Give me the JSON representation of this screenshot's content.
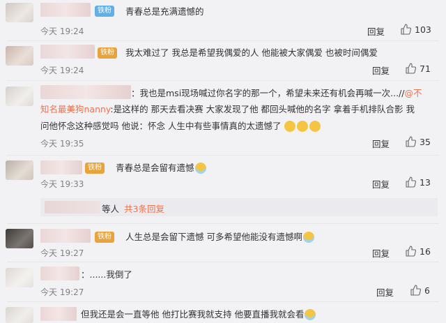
{
  "comments": [
    {
      "badge": "铁粉",
      "text": "青春总是充满遗憾的",
      "time": "今天 19:24",
      "reply": "回复",
      "likes": "103"
    },
    {
      "badge": "铁粉",
      "text": "我太难过了 我总是希望我偶爱的人 他能被大家偶爱 也被时间偶爱",
      "time": "今天 19:24",
      "reply": "回复",
      "likes": "71"
    },
    {
      "text_l1": "：我也是msi现场喊过你名字的那一个，希望未来还有机会再喊一次...//",
      "at1": "@不",
      "at2": "知名最美狗nanny",
      "text_l2": ":是这样的 那天去看决赛 大家发现了他 都回头喊他的名字 拿着手机排队合影 我",
      "text_l3": "问他怀念这种感觉吗 他说：怀念 人生中有些事情真的太遗憾了",
      "time": "今天 19:35",
      "reply": "回复",
      "likes": "35"
    },
    {
      "badge": "铁粉",
      "text": "青春总是会留有遗憾",
      "time": "今天 19:33",
      "reply": "回复",
      "likes": "13"
    },
    {
      "badge": "铁粉",
      "text": "人生总是会留下遗憾 可多希望他能没有遗憾啊",
      "time": "今天 19:27",
      "reply": "回复",
      "likes": "16"
    },
    {
      "text": "：......我倒了",
      "time": "今天 19:27",
      "reply": "回复",
      "likes": "6"
    },
    {
      "text": "但我还是会一直等他 他打比赛我就支持 他要直播我就会看"
    }
  ],
  "subreplies": {
    "prefix": "等人",
    "count_link": "共3条回复"
  }
}
